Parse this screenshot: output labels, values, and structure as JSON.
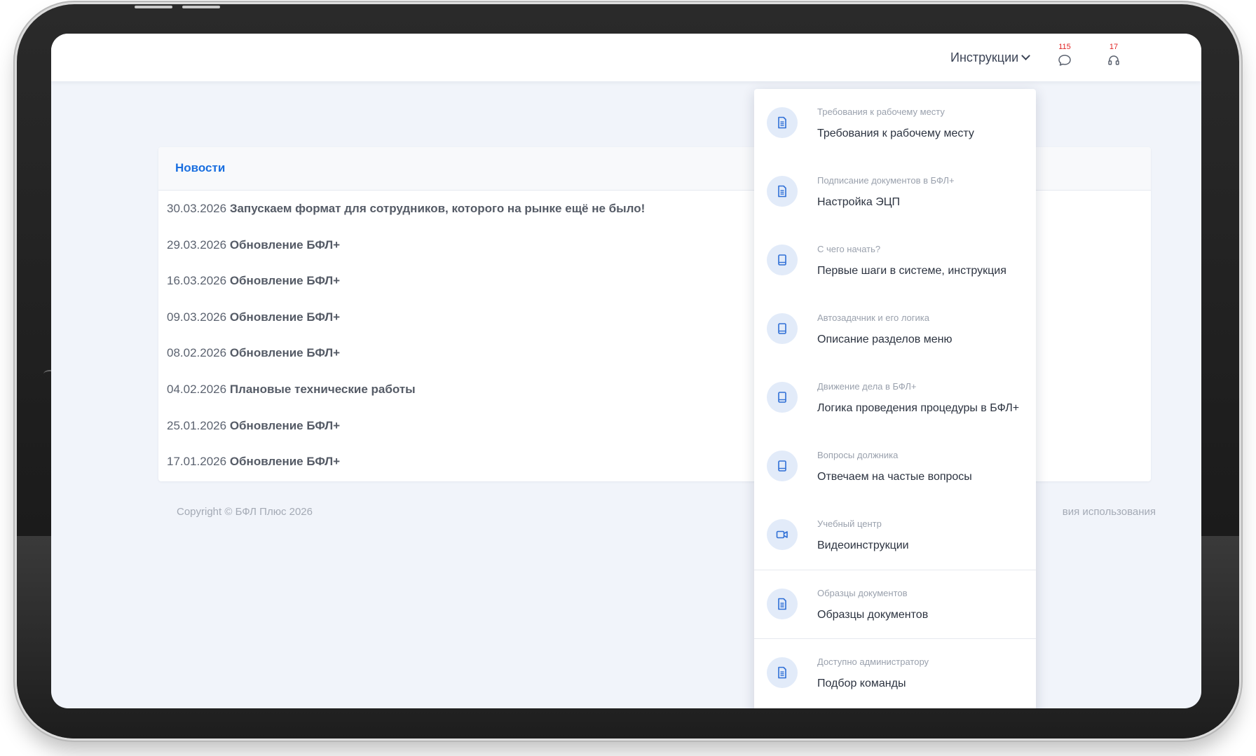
{
  "header": {
    "instructions_label": "Инструкции",
    "chat_count": "115",
    "support_count": "17"
  },
  "news": {
    "title": "Новости",
    "items": [
      {
        "date": "30.03.2026",
        "headline": "Запускаем формат для сотрудников, которого на рынке ещё не было!"
      },
      {
        "date": "29.03.2026",
        "headline": "Обновление БФЛ+"
      },
      {
        "date": "16.03.2026",
        "headline": "Обновление БФЛ+"
      },
      {
        "date": "09.03.2026",
        "headline": "Обновление БФЛ+"
      },
      {
        "date": "08.02.2026",
        "headline": "Обновление БФЛ+"
      },
      {
        "date": "04.02.2026",
        "headline": "Плановые технические работы"
      },
      {
        "date": "25.01.2026",
        "headline": "Обновление БФЛ+"
      },
      {
        "date": "17.01.2026",
        "headline": "Обновление БФЛ+"
      }
    ]
  },
  "footer": {
    "copyright": "Copyright © БФЛ Плюс 2026",
    "terms_partial": "вия использования"
  },
  "dropdown": {
    "items": [
      {
        "category": "Требования к рабочему месту",
        "label": "Требования к рабочему месту",
        "icon": "document-icon"
      },
      {
        "category": "Подписание документов в БФЛ+",
        "label": "Настройка ЭЦП",
        "icon": "document-icon"
      },
      {
        "category": "С чего начать?",
        "label": "Первые шаги в системе, инструкция",
        "icon": "book-icon"
      },
      {
        "category": "Автозадачник и его логика",
        "label": "Описание разделов меню",
        "icon": "book-icon"
      },
      {
        "category": "Движение дела в БФЛ+",
        "label": "Логика проведения процедуры в БФЛ+",
        "icon": "book-icon"
      },
      {
        "category": "Вопросы должника",
        "label": "Отвечаем на частые вопросы",
        "icon": "book-icon"
      },
      {
        "category": "Учебный центр",
        "label": "Видеоинструкции",
        "icon": "video-icon"
      },
      {
        "category": "Образцы документов",
        "label": "Образцы документов",
        "icon": "document-icon"
      },
      {
        "category": "Доступно администратору",
        "label": "Подбор команды",
        "icon": "document-icon"
      }
    ]
  },
  "colors": {
    "accent": "#1a6fe0",
    "badge": "#e02424",
    "icon_bg": "#e2ebf9",
    "icon_fg": "#2f6fd6",
    "page_bg": "#f1f4fa"
  }
}
